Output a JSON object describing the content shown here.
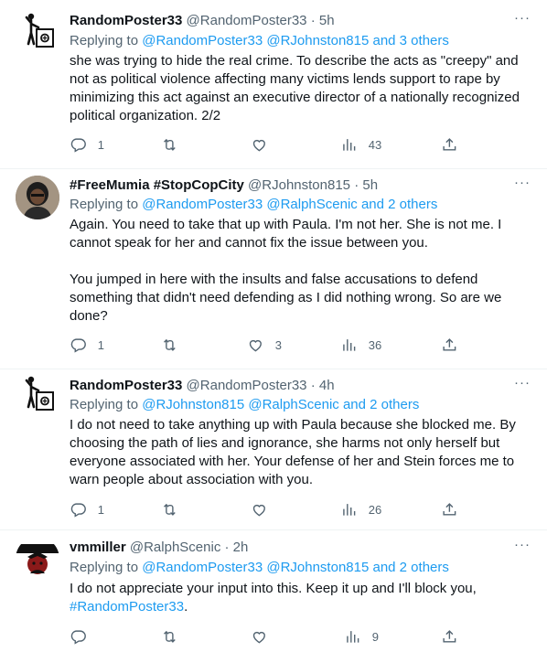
{
  "tweets": [
    {
      "name": "RandomPoster33",
      "handle": "@RandomPoster33",
      "dot": "·",
      "time": "5h",
      "more": "···",
      "replying_prefix": "Replying to ",
      "replying_links": "@RandomPoster33 @RJohnston815 and 3 others",
      "body": [
        "she was trying to hide the real crime. To describe the acts as \"creepy\" and not as political violence affecting many victims lends support to rape by minimizing this act against an executive director of a nationally recognized political organization. 2/2"
      ],
      "replies": "1",
      "retweets": "",
      "likes": "",
      "views": "43"
    },
    {
      "name": "#FreeMumia #StopCopCity",
      "handle": "@RJohnston815",
      "dot": "·",
      "time": "5h",
      "more": "···",
      "replying_prefix": "Replying to ",
      "replying_links": "@RandomPoster33 @RalphScenic and 2 others",
      "body": [
        "Again. You need to take that up with Paula. I'm not her. She is not me. I cannot speak for her and cannot fix the issue between you.",
        "You jumped in here with the insults and false accusations to defend something that didn't need defending as I did nothing wrong. So are we done?"
      ],
      "replies": "1",
      "retweets": "",
      "likes": "3",
      "views": "36"
    },
    {
      "name": "RandomPoster33",
      "handle": "@RandomPoster33",
      "dot": "·",
      "time": "4h",
      "more": "···",
      "replying_prefix": "Replying to ",
      "replying_links": "@RJohnston815 @RalphScenic and 2 others",
      "body": [
        "I do not need to take anything up with Paula because she blocked me. By choosing the path of lies and ignorance, she harms not only herself but everyone associated with her. Your defense of her and Stein forces me to warn people about association with you."
      ],
      "replies": "1",
      "retweets": "",
      "likes": "",
      "views": "26"
    },
    {
      "name": "vmmiller",
      "handle": "@RalphScenic",
      "dot": "·",
      "time": "2h",
      "more": "···",
      "replying_prefix": "Replying to ",
      "replying_links": "@RandomPoster33 @RJohnston815 and 2 others",
      "body_plain": "I do not appreciate your input into this. Keep it up and I'll block you, ",
      "body_link": "#RandomPoster33",
      "body_end": ".",
      "replies": "",
      "retweets": "",
      "likes": "",
      "views": "9"
    }
  ],
  "icons": {
    "reply": "reply-icon",
    "retweet": "retweet-icon",
    "like": "heart-icon",
    "views": "views-icon",
    "share": "share-icon",
    "more": "more-icon"
  },
  "colors": {
    "link": "#1d9bf0",
    "muted": "#536471",
    "text": "#0f1419"
  }
}
